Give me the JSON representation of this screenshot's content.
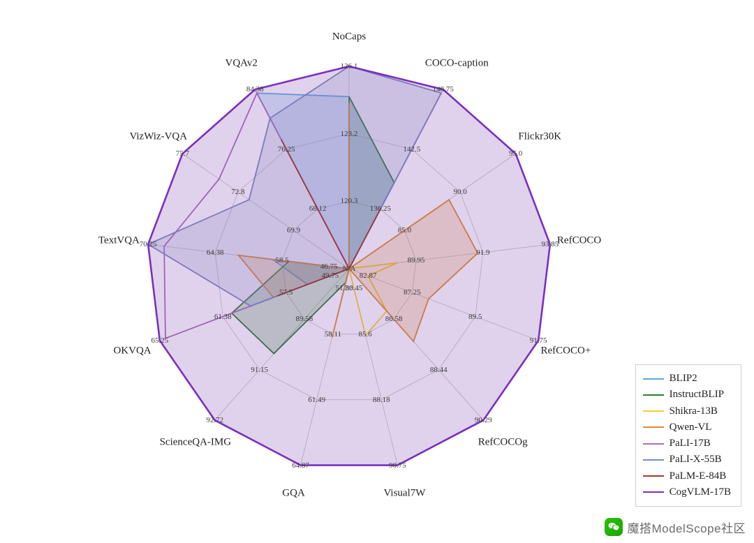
{
  "chart_data": {
    "type": "radar",
    "center_label": "N/A",
    "axes": [
      "NoCaps",
      "COCO-caption",
      "Flickr30K",
      "RefCOCO",
      "RefCOCO+",
      "RefCOCOg",
      "Visual7W",
      "GQA",
      "ScienceQA-IMG",
      "OKVQA",
      "TextVQA",
      "VizWiz-VQA",
      "VQAv2"
    ],
    "ring_labels": {
      "NoCaps": [
        "120.3",
        "123.2",
        "126.1"
      ],
      "COCO-caption": [
        "136.25",
        "142.5",
        "148.75"
      ],
      "Flickr30K": [
        "85.0",
        "90.0",
        "95.0"
      ],
      "RefCOCO": [
        "89.95",
        "91.9",
        "93.85"
      ],
      "RefCOCO+": [
        "87.25",
        "89.5",
        "91.75"
      ],
      "RefCOCOg": [
        "86.58",
        "88.44",
        "90.29"
      ],
      "Visual7W": [
        "85.6",
        "88.18",
        "90.75"
      ],
      "GQA": [
        "58.11",
        "61.49",
        "64.87"
      ],
      "ScienceQA-IMG": [
        "89.58",
        "91.15",
        "92.72"
      ],
      "OKVQA": [
        "57.5",
        "61.38",
        "65.25"
      ],
      "TextVQA": [
        "58.5",
        "64.38",
        "70.25"
      ],
      "VizWiz-VQA": [
        "69.9",
        "72.8",
        "75.7"
      ],
      "VQAv2": [
        "68.12",
        "76.25",
        "84.38"
      ]
    },
    "extra_axis_ticks": {
      "TextVQA": {
        "pos": -0.7,
        "text": "46.75"
      },
      "OKVQA": {
        "pos": -0.7,
        "text": "49.75"
      },
      "GQA": {
        "pos": -0.7,
        "text": "51.36"
      },
      "Visual7W": {
        "pos": -0.7,
        "text": "80.45"
      },
      "RefCOCO+": {
        "pos": -0.7,
        "text": "82.87"
      }
    },
    "series": [
      {
        "name": "BLIP2",
        "color": "#5aaae4",
        "fill_alpha": 0.22,
        "values": [
          0.85,
          0.48,
          0,
          0,
          0,
          0,
          0,
          0.25,
          0,
          0.22,
          0.38,
          0,
          0.98
        ]
      },
      {
        "name": "InstructBLIP",
        "color": "#2e7d32",
        "fill_alpha": 0.22,
        "values": [
          0.85,
          0.48,
          0,
          0,
          0,
          0,
          0,
          0.07,
          0.56,
          0.62,
          0.3,
          0,
          0
        ]
      },
      {
        "name": "Shikra-13B",
        "color": "#efcf35",
        "fill_alpha": 0.0,
        "values": [
          0,
          0,
          0,
          0.24,
          0.1,
          0.28,
          0.34,
          0,
          0,
          0,
          0,
          0,
          0
        ]
      },
      {
        "name": "Qwen-VL",
        "color": "#e08a2f",
        "fill_alpha": 0.22,
        "values": [
          0.82,
          0,
          0.6,
          0.64,
          0.42,
          0.48,
          0,
          0.35,
          0,
          0.4,
          0.55,
          0,
          0
        ]
      },
      {
        "name": "PaLI-17B",
        "color": "#aa6fb7",
        "fill_alpha": 0.0,
        "values": [
          0,
          0.98,
          0,
          0,
          0,
          0,
          0,
          0,
          0,
          0.97,
          0.92,
          0.78,
          0.98
        ]
      },
      {
        "name": "PaLI-X-55B",
        "color": "#7b8bbd",
        "fill_alpha": 0.2,
        "values": [
          1.0,
          0.98,
          0,
          0,
          0,
          0,
          0,
          0,
          0,
          0.52,
          1.0,
          0.6,
          0.84
        ]
      },
      {
        "name": "PaLM-E-84B",
        "color": "#a33b2b",
        "fill_alpha": 0.0,
        "values": [
          0,
          0.34,
          0,
          0,
          0,
          0,
          0,
          0,
          0,
          0.38,
          0,
          0,
          0.72
        ]
      },
      {
        "name": "CogVLM-17B",
        "color": "#7b2fbf",
        "fill_alpha": 0.18,
        "values": [
          1.0,
          1.0,
          1.0,
          1.0,
          1.0,
          1.0,
          1.0,
          1.0,
          1.0,
          1.0,
          1.0,
          1.0,
          1.0
        ]
      }
    ]
  },
  "legend": {
    "items": [
      {
        "label": "BLIP2",
        "color": "#5aaae4"
      },
      {
        "label": "InstructBLIP",
        "color": "#2e7d32"
      },
      {
        "label": "Shikra-13B",
        "color": "#efcf35"
      },
      {
        "label": "Qwen-VL",
        "color": "#e08a2f"
      },
      {
        "label": "PaLI-17B",
        "color": "#aa6fb7"
      },
      {
        "label": "PaLI-X-55B",
        "color": "#7b8bbd"
      },
      {
        "label": "PaLM-E-84B",
        "color": "#a33b2b"
      },
      {
        "label": "CogVLM-17B",
        "color": "#7b2fbf"
      }
    ]
  },
  "footer": {
    "text": "魔搭ModelScope社区"
  }
}
